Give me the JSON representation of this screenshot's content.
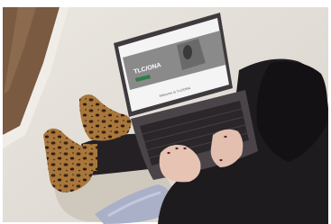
{
  "photo": {
    "screen": {
      "brand_heading": "TLC/ONA",
      "welcome_text": "Welcome to TLC/ONA"
    },
    "colors": {
      "rug": "#e4e0d9",
      "floor": "#7a5a40",
      "laptop_body": "#3f3a3d",
      "screen_banner": "#8a8a8a",
      "leopard_base": "#a9773c",
      "sweater": "#1e1b1e",
      "blanket": "#a9b0c8"
    }
  }
}
